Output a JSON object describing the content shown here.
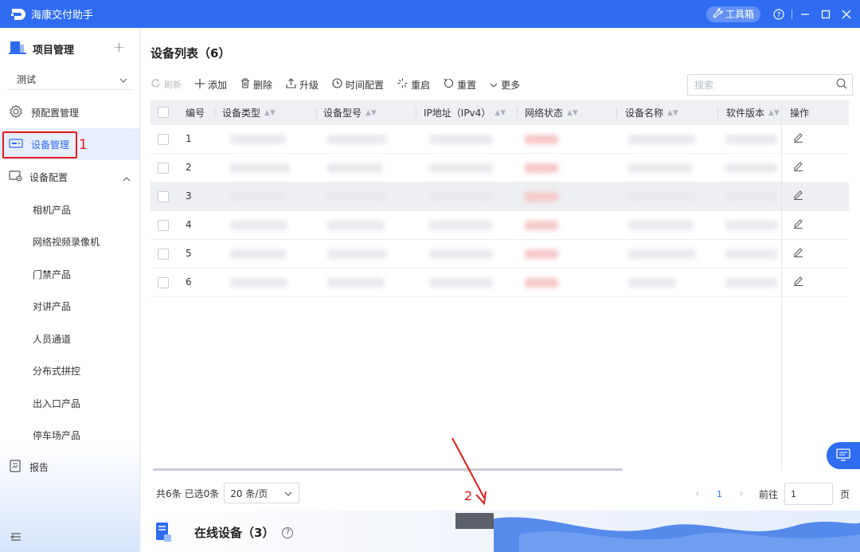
{
  "app": {
    "title": "海康交付助手",
    "toolbox_label": "工具箱"
  },
  "sidebar": {
    "project_header": "项目管理",
    "project_selected": "测试",
    "items": [
      {
        "label": "预配置管理",
        "icon": "gear-settings-icon"
      },
      {
        "label": "设备管理",
        "icon": "device-icon",
        "active": true
      },
      {
        "label": "设备配置",
        "icon": "device-config-icon",
        "expanded": true
      },
      {
        "label": "相机产品"
      },
      {
        "label": "网络视频录像机"
      },
      {
        "label": "门禁产品"
      },
      {
        "label": "对讲产品"
      },
      {
        "label": "人员通道"
      },
      {
        "label": "分布式拼控"
      },
      {
        "label": "出入口产品"
      },
      {
        "label": "停车场产品"
      },
      {
        "label": "报告",
        "icon": "report-icon"
      }
    ]
  },
  "main": {
    "title": "设备列表（6）",
    "toolbar": {
      "refresh": "刷新",
      "add": "添加",
      "delete": "删除",
      "upgrade": "升级",
      "time_config": "时间配置",
      "reboot": "重启",
      "reset": "重置",
      "more": "更多"
    },
    "search_placeholder": "搜索",
    "columns": [
      "编号",
      "设备类型",
      "设备型号",
      "IP地址（IPv4）",
      "网络状态",
      "设备名称",
      "软件版本",
      "操作"
    ],
    "rows": [
      "1",
      "2",
      "3",
      "4",
      "5",
      "6"
    ],
    "footer": {
      "total": "共6条",
      "selected": "已选0条",
      "page_size": "20 条/页",
      "current_page": "1",
      "goto_label": "前往",
      "goto_value": "1",
      "page_suffix": "页"
    }
  },
  "online_panel": {
    "title": "在线设备（3）"
  },
  "annotations": {
    "one": "1",
    "two": "2"
  },
  "colors": {
    "accent": "#2f6cf2",
    "annotation": "#e31b1b"
  }
}
